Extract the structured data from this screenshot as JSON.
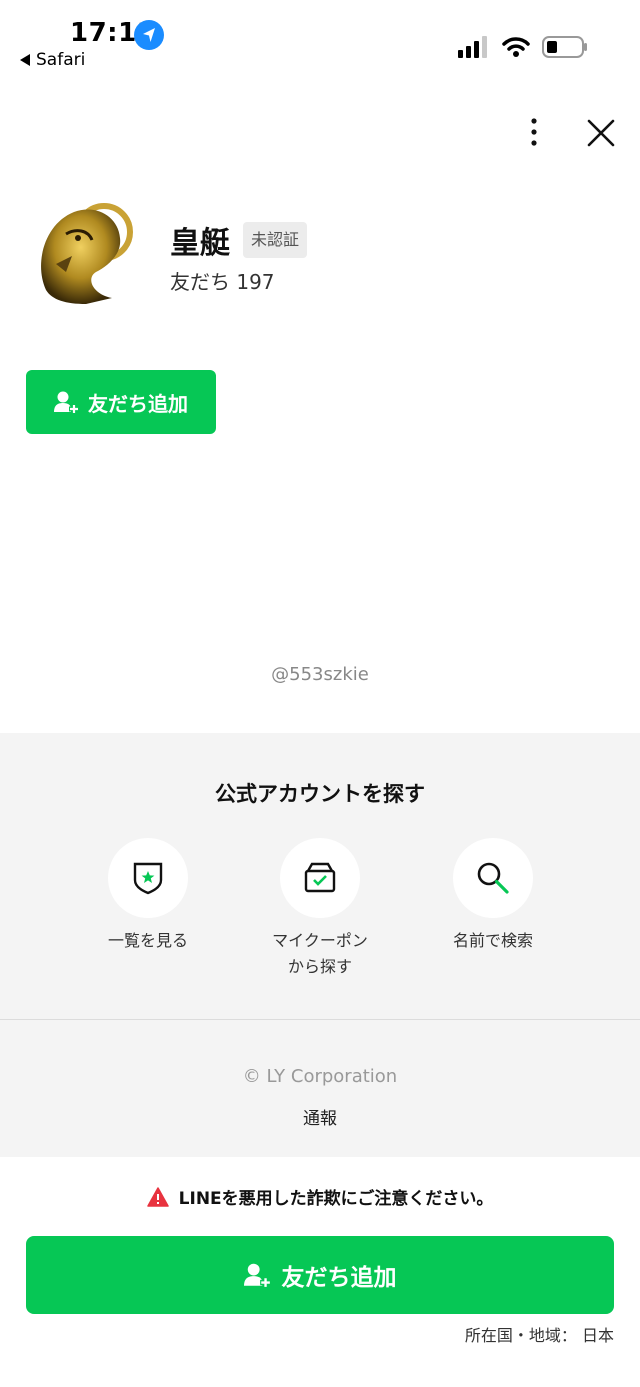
{
  "status_bar": {
    "time": "17:11",
    "back_app": "Safari"
  },
  "profile": {
    "name": "皇艇",
    "badge": "未認証",
    "friends": "友だち 197",
    "add_friend_label": "友だち追加",
    "account_id": "@553szkie"
  },
  "explore": {
    "title": "公式アカウントを探す",
    "items": [
      {
        "label_line1": "一覧を見る",
        "label_line2": "",
        "icon": "shield-star-icon"
      },
      {
        "label_line1": "マイクーポン",
        "label_line2": "から探す",
        "icon": "coupon-box-icon"
      },
      {
        "label_line1": "名前で検索",
        "label_line2": "",
        "icon": "search-icon"
      }
    ]
  },
  "footer": {
    "copyright": "© LY Corporation",
    "report": "通報"
  },
  "bottom": {
    "warning": "LINEを悪用した詐欺にご注意ください。",
    "add_friend_label": "友だち追加",
    "region": "所在国・地域： 日本"
  },
  "colors": {
    "accent": "#06c755",
    "warning": "#e8333f",
    "gray_bg": "#f4f4f4"
  }
}
